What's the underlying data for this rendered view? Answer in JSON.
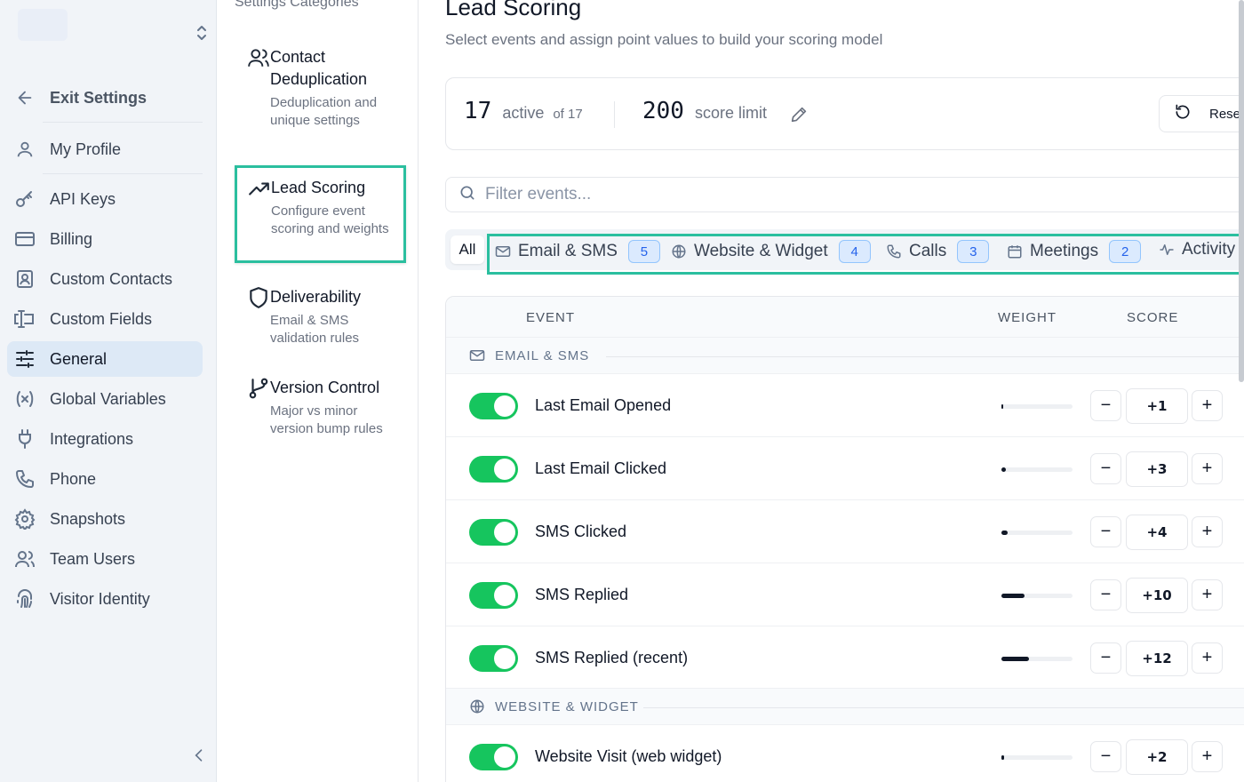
{
  "sidebar": {
    "exit_label": "Exit Settings",
    "items": [
      {
        "label": "My Profile",
        "icon": "user-icon"
      },
      {
        "label": "API Keys",
        "icon": "key-icon"
      },
      {
        "label": "Billing",
        "icon": "credit-card-icon"
      },
      {
        "label": "Custom Contacts",
        "icon": "contact-card-icon"
      },
      {
        "label": "Custom Fields",
        "icon": "text-field-icon"
      },
      {
        "label": "General",
        "icon": "sliders-icon",
        "active": true
      },
      {
        "label": "Global Variables",
        "icon": "variable-icon"
      },
      {
        "label": "Integrations",
        "icon": "plug-icon"
      },
      {
        "label": "Phone",
        "icon": "phone-icon"
      },
      {
        "label": "Snapshots",
        "icon": "gear-icon"
      },
      {
        "label": "Team Users",
        "icon": "users-icon"
      },
      {
        "label": "Visitor Identity",
        "icon": "fingerprint-icon"
      }
    ]
  },
  "categories": {
    "title": "Settings Categories",
    "items": [
      {
        "title": "Contact Deduplication",
        "desc": "Deduplication and unique settings",
        "icon": "users-icon"
      },
      {
        "title": "Lead Scoring",
        "desc": "Configure event scoring and weights",
        "icon": "trending-up-icon",
        "active": true
      },
      {
        "title": "Deliverability",
        "desc": "Email & SMS validation rules",
        "icon": "shield-icon"
      },
      {
        "title": "Version Control",
        "desc": "Major vs minor version bump rules",
        "icon": "git-branch-icon"
      }
    ]
  },
  "main": {
    "title": "Lead Scoring",
    "subtitle": "Select events and assign point values to build your scoring model",
    "stats": {
      "active_count": "17",
      "active_label": "active",
      "of_label": "of 17",
      "limit_value": "200",
      "limit_label": "score limit",
      "reset_label": "Reset"
    },
    "filter": {
      "placeholder": "Filter events..."
    },
    "tabs": {
      "all_label": "All",
      "items": [
        {
          "label": "Email & SMS",
          "count": "5",
          "icon": "mail-icon"
        },
        {
          "label": "Website & Widget",
          "count": "4",
          "icon": "globe-icon"
        },
        {
          "label": "Calls",
          "count": "3",
          "icon": "phone-icon"
        },
        {
          "label": "Meetings",
          "count": "2",
          "icon": "calendar-icon"
        },
        {
          "label": "Activity",
          "icon": "activity-icon"
        }
      ]
    },
    "table": {
      "headers": {
        "event": "EVENT",
        "weight": "WEIGHT",
        "score": "SCORE"
      },
      "groups": [
        {
          "label": "EMAIL & SMS",
          "icon": "mail-icon",
          "rows": [
            {
              "name": "Last Email Opened",
              "score": "+1",
              "weight": 0.01,
              "enabled": true
            },
            {
              "name": "Last Email Clicked",
              "score": "+3",
              "weight": 0.06,
              "enabled": true
            },
            {
              "name": "SMS Clicked",
              "score": "+4",
              "weight": 0.09,
              "enabled": true
            },
            {
              "name": "SMS Replied",
              "score": "+10",
              "weight": 0.32,
              "enabled": true
            },
            {
              "name": "SMS Replied (recent)",
              "score": "+12",
              "weight": 0.39,
              "enabled": true
            }
          ]
        },
        {
          "label": "WEBSITE & WIDGET",
          "icon": "globe-icon",
          "rows": [
            {
              "name": "Website Visit (web widget)",
              "score": "+2",
              "weight": 0.04,
              "enabled": true
            }
          ]
        }
      ]
    }
  }
}
